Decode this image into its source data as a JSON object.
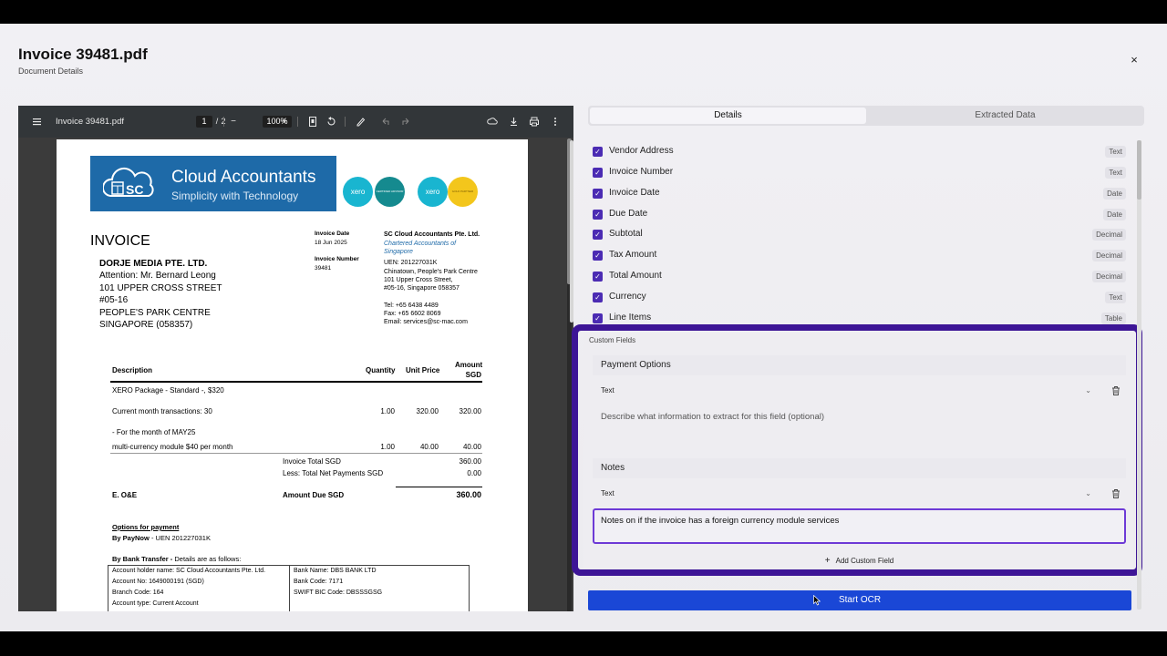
{
  "modal": {
    "title": "Invoice 39481.pdf",
    "subtitle": "Document Details",
    "close_label": "×"
  },
  "viewer": {
    "filename": "Invoice 39481.pdf",
    "page_current": "1",
    "page_sep": "/",
    "page_total": "2",
    "zoom": "100%",
    "zoom_out": "−",
    "zoom_in": "+"
  },
  "invoice": {
    "logo_title": "Cloud Accountants",
    "logo_tagline": "Simplicity with Technology",
    "logo_mark": "SC",
    "badge1": "xero",
    "badge2": "CERTIFIED ADVISOR",
    "badge3": "xero",
    "badge4": "GOLD PARTNER",
    "heading": "INVOICE",
    "bill_to": [
      "DORJE MEDIA PTE. LTD.",
      "Attention: Mr. Bernard Leong",
      "101 UPPER CROSS STREET",
      "#05-16",
      "PEOPLE'S PARK CENTRE",
      "SINGAPORE (058357)"
    ],
    "date_label": "Invoice Date",
    "date_value": "18 Jun 2025",
    "number_label": "Invoice Number",
    "number_value": "39481",
    "company": [
      "SC Cloud Accountants Pte. Ltd.",
      "Chartered Accountants of",
      "Singapore",
      "UEN: 201227031K",
      "Chinatown, People's Park Centre",
      "101 Upper Cross Street,",
      "#05-16, Singapore 058357",
      "",
      "Tel: +65 6438 4489",
      "Fax: +65 6602 8069",
      "Email: services@sc-mac.com"
    ],
    "col_description": "Description",
    "col_quantity": "Quantity",
    "col_unit_price": "Unit Price",
    "col_amount": "Amount",
    "col_amount_cur": "SGD",
    "line1": "XERO Package - Standard -, $320",
    "line2_desc": "Current month transactions: 30",
    "line2_qty": "1.00",
    "line2_price": "320.00",
    "line2_amt": "320.00",
    "line3": "- For the month of MAY25",
    "line4_desc": "multi-currency module $40 per month",
    "line4_qty": "1.00",
    "line4_price": "40.00",
    "line4_amt": "40.00",
    "total_label": "Invoice Total SGD",
    "total_value": "360.00",
    "paid_label": "Less: Total Net Payments SGD",
    "paid_value": "0.00",
    "eoe": "E. O&E",
    "due_label": "Amount Due SGD",
    "due_value": "360.00",
    "pay_heading": "Options for payment",
    "paynow_bold": "By PayNow",
    "paynow_rest": " - UEN 201227031K",
    "bank_bold": "By Bank Transfer -",
    "bank_rest": " Details are as follows:",
    "bank_left": [
      "Account holder name: SC Cloud Accountants Pte. Ltd.",
      "Account No: 1649000191 (SGD)",
      "Branch Code: 164",
      "Account type: Current Account"
    ],
    "bank_right": [
      "Bank Name: DBS BANK LTD",
      "Bank Code: 7171",
      "SWIFT BIC Code: DBSSSGSG"
    ]
  },
  "tabs": {
    "details": "Details",
    "extracted": "Extracted Data"
  },
  "fields": [
    {
      "label": "Vendor Address",
      "type": "Text"
    },
    {
      "label": "Invoice Number",
      "type": "Text"
    },
    {
      "label": "Invoice Date",
      "type": "Date"
    },
    {
      "label": "Due Date",
      "type": "Date"
    },
    {
      "label": "Subtotal",
      "type": "Decimal"
    },
    {
      "label": "Tax Amount",
      "type": "Decimal"
    },
    {
      "label": "Total Amount",
      "type": "Decimal"
    },
    {
      "label": "Currency",
      "type": "Text"
    },
    {
      "label": "Line Items",
      "type": "Table"
    }
  ],
  "custom": {
    "heading": "Custom Fields",
    "f1_name": "Payment Options",
    "f1_type": "Text",
    "f1_desc_placeholder": "Describe what information to extract for this field (optional)",
    "f2_name": "Notes",
    "f2_type": "Text",
    "f2_desc_value": "Notes on if the invoice has a foreign currency module services",
    "add_label": "Add Custom Field"
  },
  "start_label": "Start OCR",
  "colors": {
    "accent": "#4b2bb3",
    "highlight": "#3d1596",
    "primary_button": "#1a47d6",
    "logo_blue": "#1e6aa8"
  }
}
